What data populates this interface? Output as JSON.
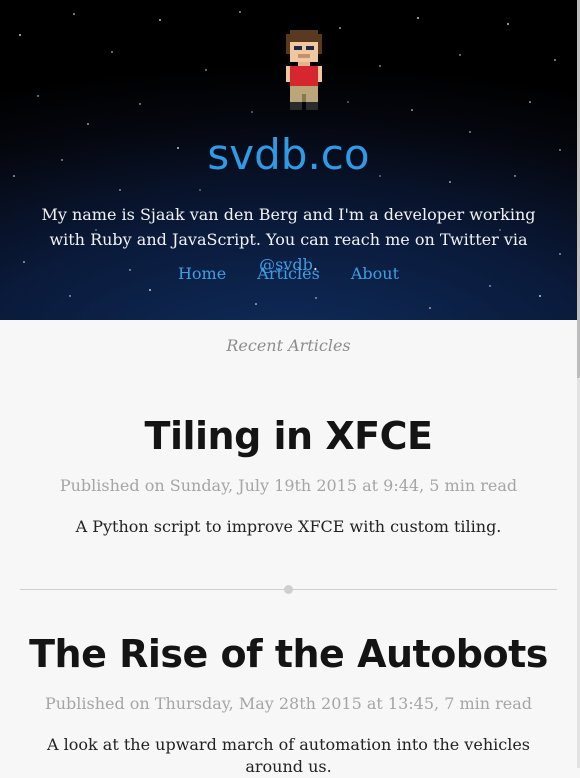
{
  "header": {
    "site_title": "svdb.co",
    "intro_text": "My name is Sjaak van den Berg and I'm a developer working with Ruby and JavaScript. You can reach me on Twitter via ",
    "twitter_handle": "@svdb",
    "intro_end": ".",
    "nav": [
      "Home",
      "Articles",
      "About"
    ]
  },
  "main": {
    "section_label": "Recent Articles",
    "articles": [
      {
        "title": "Tiling in XFCE",
        "meta": "Published on Sunday, July 19th 2015 at 9:44, 5 min read",
        "excerpt": "A Python script to improve XFCE with custom tiling."
      },
      {
        "title": "The Rise of the Autobots",
        "meta": "Published on Thursday, May 28th 2015 at 13:45, 7 min read",
        "excerpt": "A look at the upward march of automation into the vehicles around us."
      }
    ]
  },
  "colors": {
    "accent": "#3c9ee5",
    "title": "#2f9ae6",
    "header_bg": "#05070f"
  }
}
